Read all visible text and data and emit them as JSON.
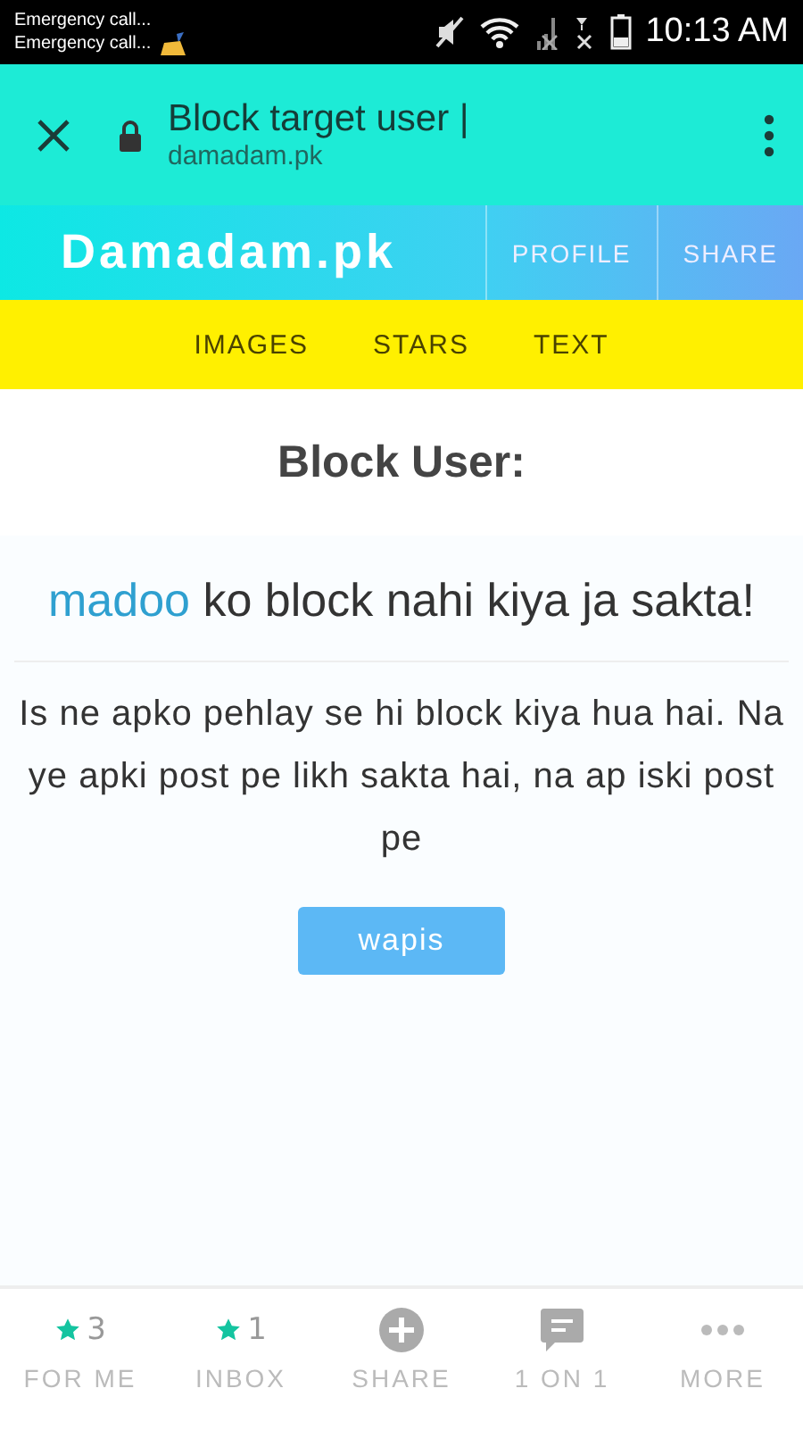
{
  "status_bar": {
    "notifications": [
      "Emergency call...",
      "Emergency call..."
    ],
    "time": "10:13 AM"
  },
  "browser": {
    "title": "Block target user |",
    "url": "damadam.pk"
  },
  "header": {
    "logo": "Damadam.pk",
    "links": [
      "PROFILE",
      "SHARE"
    ]
  },
  "subnav": [
    "IMAGES",
    "STARS",
    "TEXT"
  ],
  "page": {
    "heading": "Block User:",
    "username": "madoo",
    "message": "ko block nahi kiya ja sakta!",
    "detail": "Is ne apko pehlay se hi block kiya hua hai. Na ye apki post pe likh sakta hai, na ap iski post pe",
    "button": "wapis"
  },
  "bottom_nav": [
    {
      "kind": "count",
      "count": "3",
      "label": "FOR ME"
    },
    {
      "kind": "count",
      "count": "1",
      "label": "INBOX"
    },
    {
      "kind": "add",
      "label": "SHARE"
    },
    {
      "kind": "chat",
      "label": "1 ON 1"
    },
    {
      "kind": "more",
      "label": "MORE"
    }
  ]
}
